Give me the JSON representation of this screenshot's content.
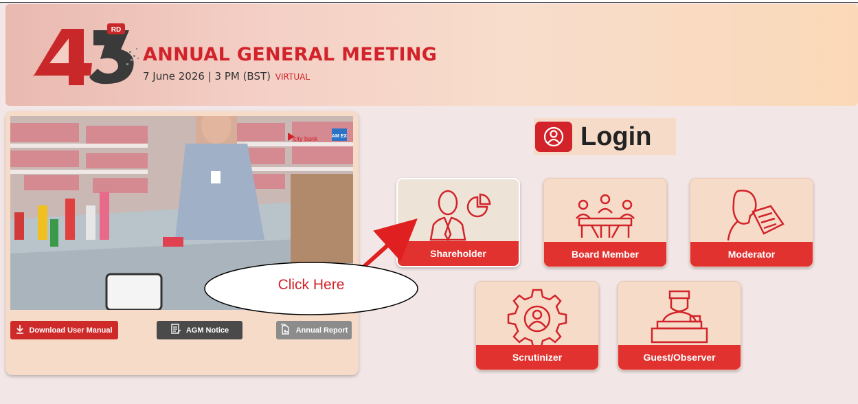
{
  "banner": {
    "number": "43",
    "ordinal": "RD",
    "title": "ANNUAL GENERAL MEETING",
    "date_line": "7 June 2026 | 3 PM (BST)",
    "mode": "VIRTUAL"
  },
  "video": {
    "brand_text": "city bank",
    "brand_badge": "AM EX"
  },
  "card_buttons": {
    "download": "Download User Manual",
    "agm_notice": "AGM Notice",
    "annual_report": "Annual Report"
  },
  "login": {
    "label": "Login"
  },
  "tiles": {
    "shareholder": "Shareholder",
    "board_member": "Board Member",
    "moderator": "Moderator",
    "scrutinizer": "Scrutinizer",
    "guest": "Guest/Observer"
  },
  "callout": {
    "text": "Click Here"
  },
  "colors": {
    "brand_red": "#d2232a",
    "tile_bg": "#f6dcc8",
    "page_bg": "#f3e6e6"
  },
  "icons": [
    "user-circle-icon",
    "shareholder-chart-icon",
    "board-meeting-icon",
    "moderator-reading-icon",
    "scrutinizer-gear-icon",
    "guest-desk-icon",
    "download-icon",
    "document-icon",
    "report-icon"
  ]
}
